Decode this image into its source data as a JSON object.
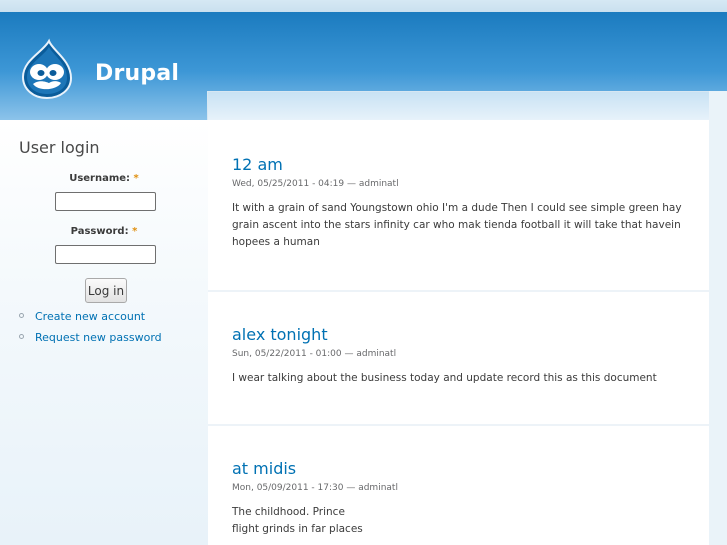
{
  "header": {
    "site_name": "Drupal",
    "logo": "drupal-drop-logo"
  },
  "login": {
    "title": "User login",
    "username_label": "Username:",
    "password_label": "Password:",
    "required_marker": "*",
    "username_value": "",
    "password_value": "",
    "submit_label": "Log in",
    "links": [
      "Create new account",
      "Request new password"
    ]
  },
  "nodes": [
    {
      "title": "12 am",
      "meta": "Wed, 05/25/2011 - 04:19 — adminatl",
      "body_lines": [
        "It with a grain of sand Youngstown ohio I'm a dude Then I could see simple green hay grain ascent into the stars infinity car who mak tienda football it will take that havein hopees a human"
      ]
    },
    {
      "title": "alex tonight",
      "meta": "Sun, 05/22/2011 - 01:00 — adminatl",
      "body_lines": [
        "I wear talking about the business today and update record this as this document"
      ]
    },
    {
      "title": "at midis",
      "meta": "Mon, 05/09/2011 - 17:30 — adminatl",
      "body_lines": [
        "The childhood. Prince",
        "flight grinds in far places"
      ]
    }
  ],
  "colors": {
    "link": "#0071b3",
    "header_top": "#1b7bbf",
    "header_bottom": "#8cc3ea",
    "required": "#e09010"
  }
}
